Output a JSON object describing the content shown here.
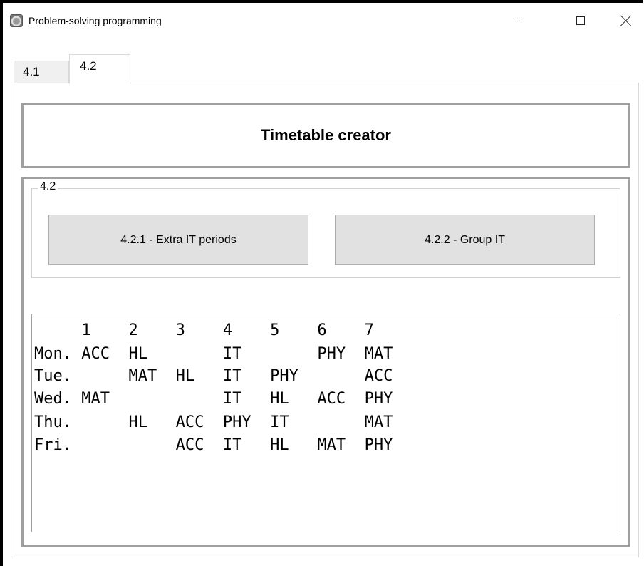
{
  "window": {
    "title": "Problem-solving programming",
    "icon": "app-icon"
  },
  "tabs": [
    {
      "label": "4.1",
      "selected": false
    },
    {
      "label": "4.2",
      "selected": true
    }
  ],
  "header": {
    "title": "Timetable creator"
  },
  "group": {
    "legend": "4.2",
    "buttons": [
      {
        "label": "4.2.1 - Extra IT periods"
      },
      {
        "label": "4.2.2 - Group IT"
      }
    ]
  },
  "timetable": {
    "lines": [
      "     1    2    3    4    5    6    7",
      "Mon. ACC  HL        IT        PHY  MAT",
      "Tue.      MAT  HL   IT   PHY       ACC",
      "Wed. MAT            IT   HL   ACC  PHY",
      "Thu.      HL   ACC  PHY  IT        MAT",
      "Fri.           ACC  IT   HL   MAT  PHY"
    ]
  }
}
